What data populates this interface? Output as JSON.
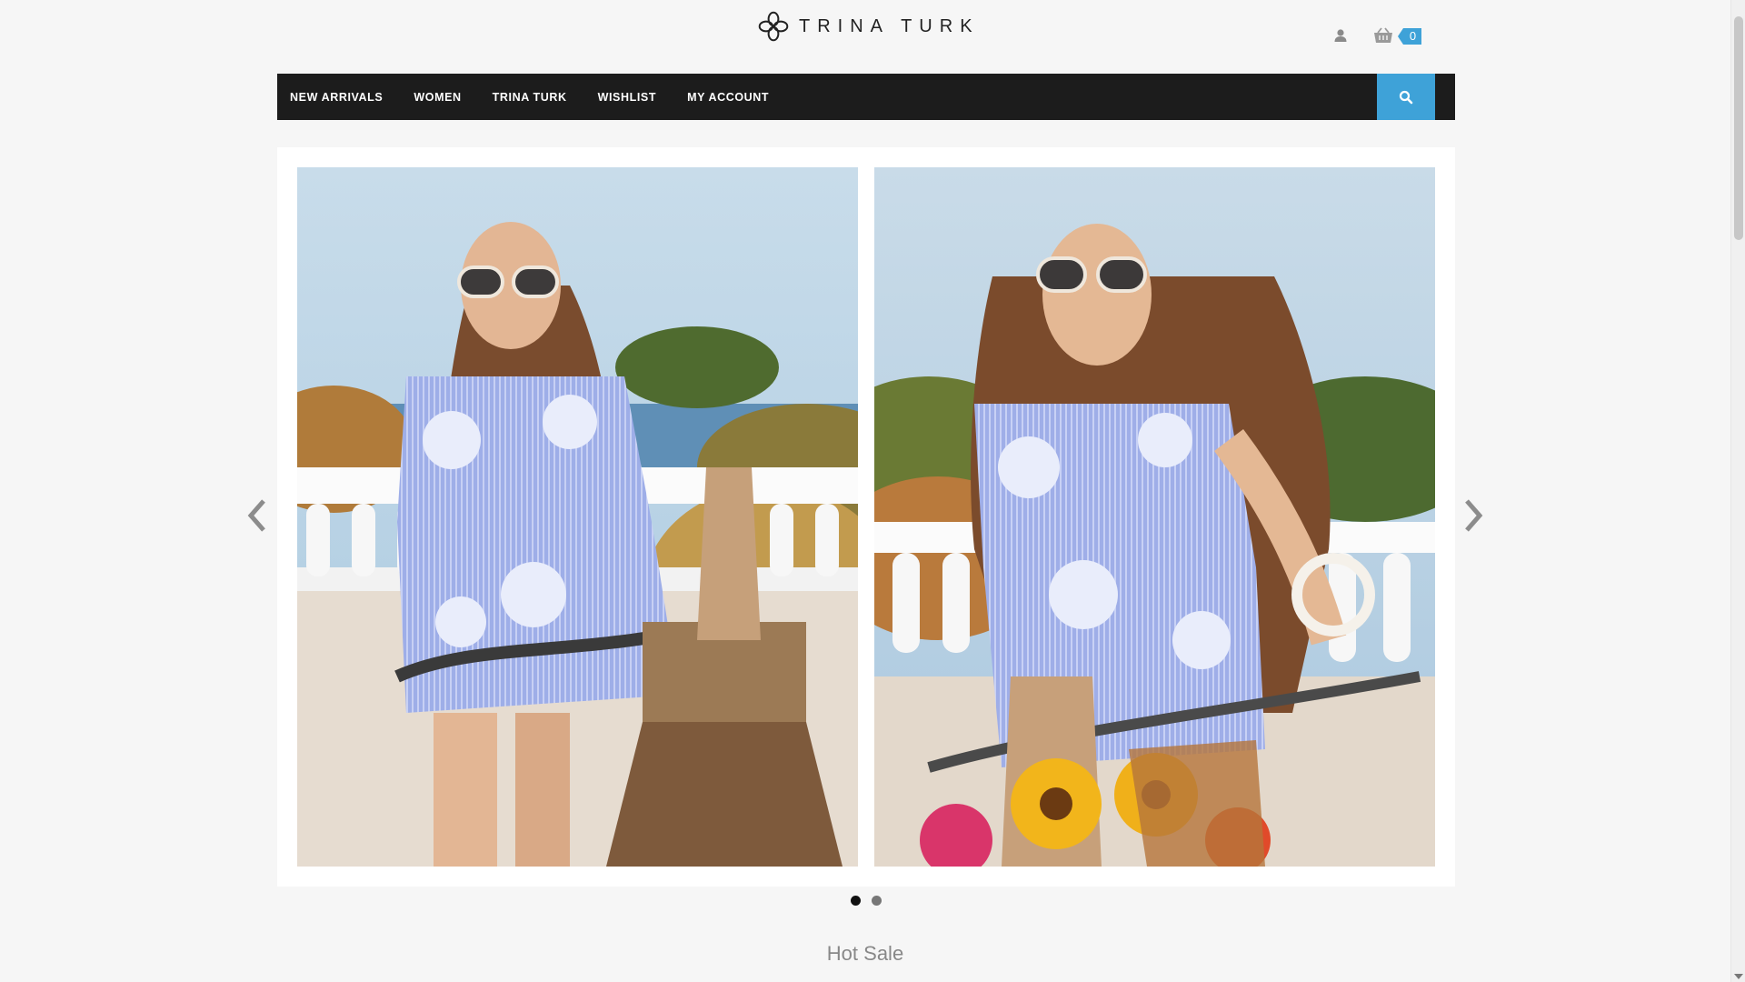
{
  "header": {
    "brand": "TRINA TURK",
    "cart_count": "0",
    "icons": {
      "user": "user-icon",
      "cart": "basket-icon"
    }
  },
  "nav": {
    "items": [
      {
        "label": "NEW ARRIVALS"
      },
      {
        "label": "WOMEN"
      },
      {
        "label": "TRINA TURK"
      },
      {
        "label": "WISHLIST"
      },
      {
        "label": "MY ACCOUNT"
      }
    ],
    "search_icon": "search-icon"
  },
  "slider": {
    "slides": [
      {
        "alt": "Model in blue floral wrap dress on bicycle"
      },
      {
        "alt": "Model in blue floral wrap dress with sunflowers"
      }
    ],
    "active_dot": 1,
    "dot_count": 2,
    "prev_icon": "chevron-left-icon",
    "next_icon": "chevron-right-icon"
  },
  "sections": {
    "hot_sale_title": "Hot Sale"
  },
  "colors": {
    "accent": "#3ea2d8",
    "nav_bg": "#1c1c1c",
    "page_bg": "#f6f6f6"
  }
}
